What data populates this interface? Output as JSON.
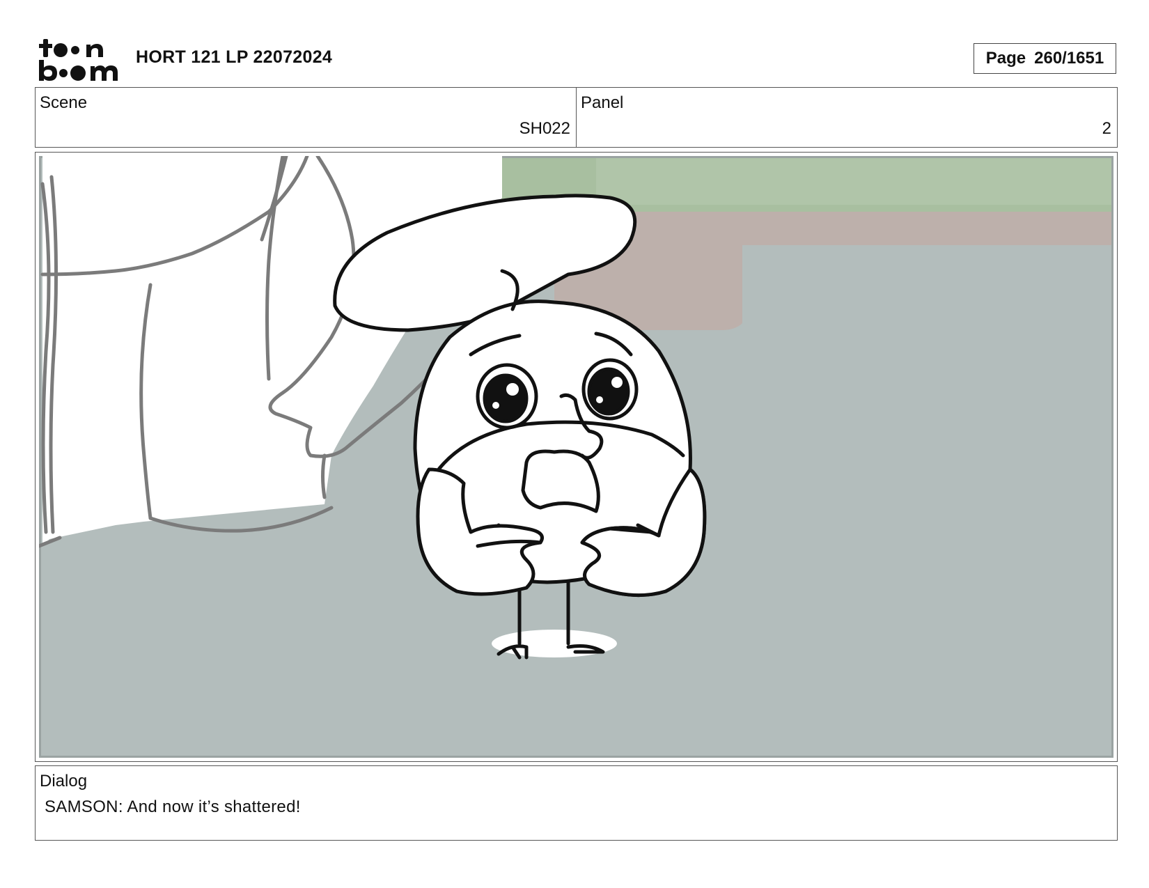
{
  "header": {
    "logo_text": "toonboom",
    "project_title": "HORT 121 LP 22072024",
    "page_label": "Page",
    "page_number": "260/1651"
  },
  "info": {
    "scene_label": "Scene",
    "scene_value": "SH022",
    "panel_label": "Panel",
    "panel_value": "2"
  },
  "dialog": {
    "label": "Dialog",
    "text": "SAMSON: And now it’s shattered!"
  },
  "colors": {
    "floor": "#b3bdbc",
    "background_wall": "#a8c0a0",
    "sofa": "#c0aeaa",
    "ink": "#111111",
    "sketch_gray": "#7a7a7a"
  }
}
